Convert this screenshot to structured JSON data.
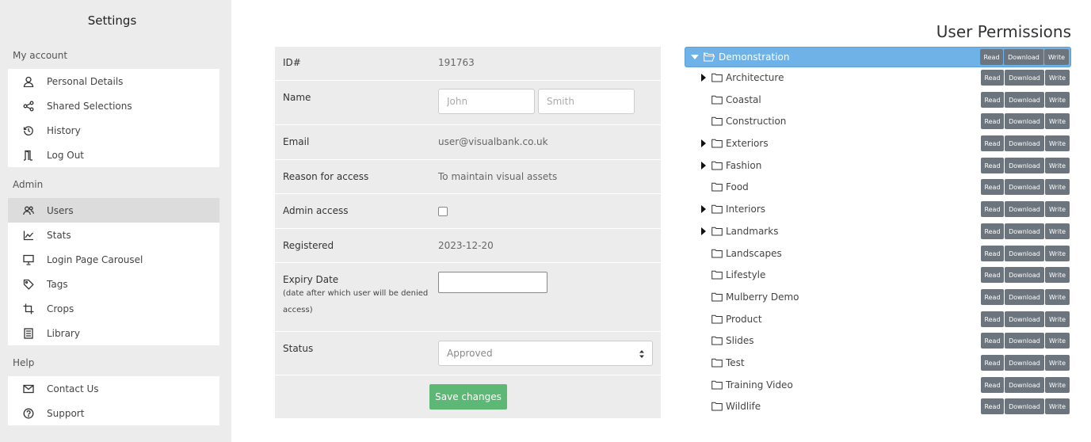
{
  "sidebar": {
    "title": "Settings",
    "sections": [
      {
        "heading": "My account",
        "items": [
          {
            "label": "Personal Details",
            "icon": "user-icon",
            "active": false
          },
          {
            "label": "Shared Selections",
            "icon": "share-icon",
            "active": false
          },
          {
            "label": "History",
            "icon": "history-icon",
            "active": false
          },
          {
            "label": "Log Out",
            "icon": "logout-icon",
            "active": false
          }
        ]
      },
      {
        "heading": "Admin",
        "items": [
          {
            "label": "Users",
            "icon": "users-icon",
            "active": true
          },
          {
            "label": "Stats",
            "icon": "stats-icon",
            "active": false
          },
          {
            "label": "Login Page Carousel",
            "icon": "presentation-icon",
            "active": false
          },
          {
            "label": "Tags",
            "icon": "tag-icon",
            "active": false
          },
          {
            "label": "Crops",
            "icon": "crop-icon",
            "active": false
          },
          {
            "label": "Library",
            "icon": "library-icon",
            "active": false
          }
        ]
      },
      {
        "heading": "Help",
        "items": [
          {
            "label": "Contact Us",
            "icon": "mail-icon",
            "active": false
          },
          {
            "label": "Support",
            "icon": "help-icon",
            "active": false
          }
        ]
      }
    ]
  },
  "form": {
    "id_label": "ID#",
    "id_value": "191763",
    "name_label": "Name",
    "first_name_placeholder": "John",
    "last_name_placeholder": "Smith",
    "email_label": "Email",
    "email_value": "user@visualbank.co.uk",
    "reason_label": "Reason for access",
    "reason_value": "To maintain visual assets",
    "admin_label": "Admin access",
    "admin_checked": false,
    "registered_label": "Registered",
    "registered_value": "2023-12-20",
    "expiry_label": "Expiry Date",
    "expiry_note": "(date after which user will be denied access)",
    "expiry_value": "",
    "status_label": "Status",
    "status_value": "Approved",
    "save_label": "Save changes"
  },
  "permissions": {
    "title": "User Permissions",
    "buttons": {
      "read": "Read",
      "download": "Download",
      "write": "Write"
    },
    "root": {
      "label": "Demonstration",
      "expanded": true
    },
    "folders": [
      {
        "label": "Architecture",
        "has_children": true
      },
      {
        "label": "Coastal",
        "has_children": false
      },
      {
        "label": "Construction",
        "has_children": false
      },
      {
        "label": "Exteriors",
        "has_children": true
      },
      {
        "label": "Fashion",
        "has_children": true
      },
      {
        "label": "Food",
        "has_children": false
      },
      {
        "label": "Interiors",
        "has_children": true
      },
      {
        "label": "Landmarks",
        "has_children": true
      },
      {
        "label": "Landscapes",
        "has_children": false
      },
      {
        "label": "Lifestyle",
        "has_children": false
      },
      {
        "label": "Mulberry Demo",
        "has_children": false
      },
      {
        "label": "Product",
        "has_children": false
      },
      {
        "label": "Slides",
        "has_children": false
      },
      {
        "label": "Test",
        "has_children": false
      },
      {
        "label": "Training Video",
        "has_children": false
      },
      {
        "label": "Wildlife",
        "has_children": false
      }
    ]
  },
  "colors": {
    "sidebar_bg": "#ececec",
    "active_item": "#dcdcdc",
    "tree_root_bg": "#6eb2e8",
    "permission_button": "#6c757d",
    "save_button": "#5cb874"
  }
}
